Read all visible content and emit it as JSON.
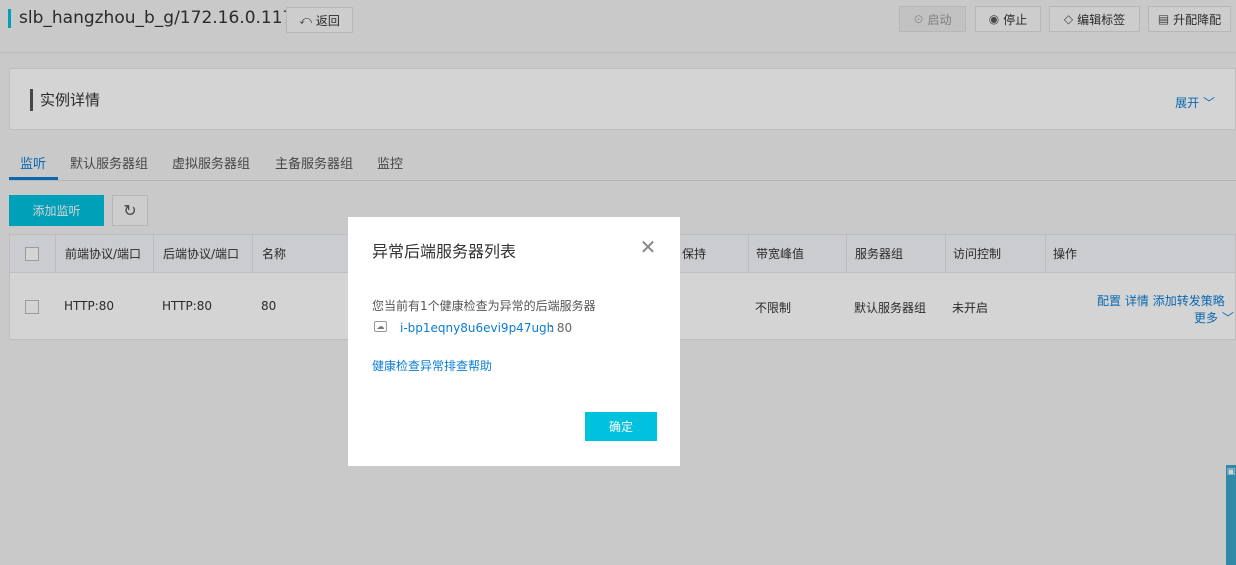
{
  "header": {
    "title": "slb_hangzhou_b_g/172.16.0.117",
    "back_label": "返回",
    "start_label": "启动",
    "stop_label": "停止",
    "edit_tags_label": "编辑标签",
    "upgrade_label": "升配降配"
  },
  "details": {
    "title": "实例详情",
    "expand_label": "展开"
  },
  "tabs": [
    {
      "label": "监听",
      "active": true
    },
    {
      "label": "默认服务器组"
    },
    {
      "label": "虚拟服务器组"
    },
    {
      "label": "主备服务器组"
    },
    {
      "label": "监控"
    }
  ],
  "toolbar": {
    "add_listener_label": "添加监听"
  },
  "table": {
    "columns": [
      "前端协议/端口",
      "后端协议/端口",
      "名称",
      "保持",
      "带宽峰值",
      "服务器组",
      "访问控制",
      "操作"
    ],
    "rows": [
      {
        "frontend": "HTTP:80",
        "backend": "HTTP:80",
        "name": "80",
        "bandwidth": "不限制",
        "server_group": "默认服务器组",
        "access_control": "未开启",
        "actions": [
          "配置",
          "详情",
          "添加转发策略"
        ],
        "more_label": "更多"
      }
    ]
  },
  "modal": {
    "title": "异常后端服务器列表",
    "message": "您当前有1个健康检查为异常的后端服务器",
    "server_id": "i-bp1eqny8u6evi9p47ugh",
    "server_port": ": 80",
    "help_link": "健康检查异常排查帮助",
    "ok_label": "确定"
  },
  "colors": {
    "accent": "#00c1de",
    "link": "#0b7dd4"
  }
}
